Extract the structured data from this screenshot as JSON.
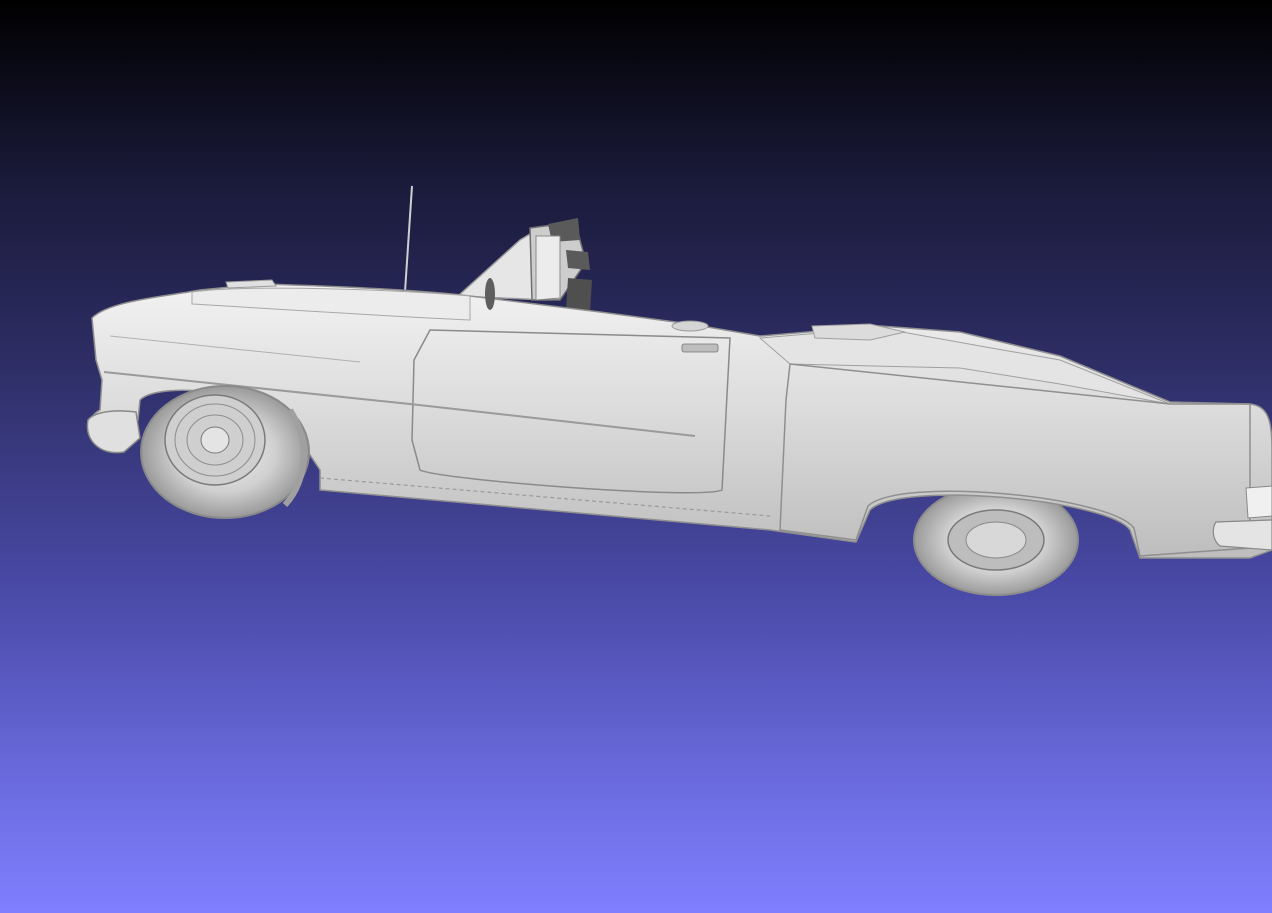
{
  "viewer": {
    "background_top": "#000000",
    "background_bottom": "#7f7fff",
    "model_color": "#d9d9d9",
    "shadow_color": "#8a8a8a",
    "model": {
      "semantic": "convertible-car-mesh",
      "badge_text": ""
    }
  }
}
